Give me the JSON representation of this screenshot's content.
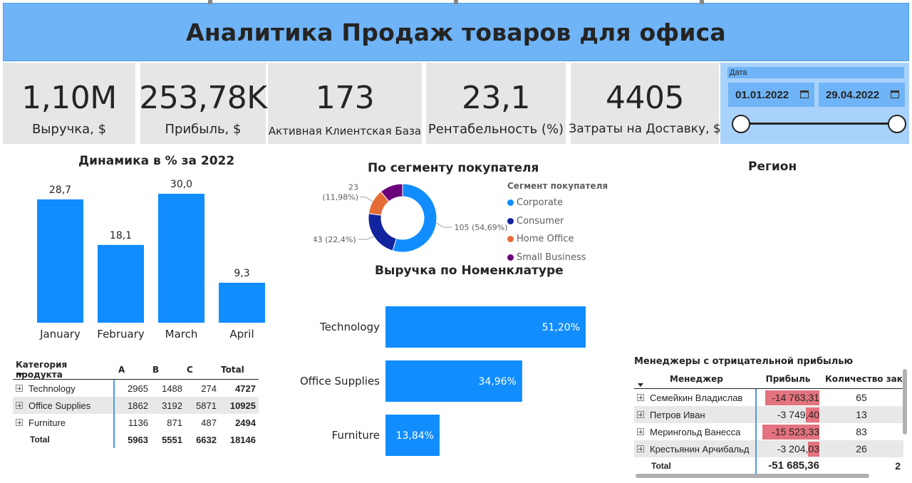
{
  "header": {
    "title": "Аналитика Продаж товаров для офиса"
  },
  "kpis": [
    {
      "value": "1,10M",
      "label": "Выручка, $"
    },
    {
      "value": "253,78K",
      "label": "Прибыль, $"
    },
    {
      "value": "173",
      "label": "Активная Клиентская База"
    },
    {
      "value": "23,1",
      "label": "Рентабельность (%)"
    },
    {
      "value": "4405",
      "label": "Затраты на Доставку, $"
    }
  ],
  "date_slicer": {
    "title": "Дата",
    "start": "01.01.2022",
    "end": "29.04.2022",
    "start_fraction": 0.0,
    "end_fraction": 1.0
  },
  "monthly_chart": {
    "title": "Динамика в % за 2022",
    "value_labels": [
      "28,7",
      "18,1",
      "30,0",
      "9,3"
    ],
    "categories": [
      "January",
      "February",
      "March",
      "April"
    ]
  },
  "segment_chart": {
    "title": "По сегменту покупателя",
    "legend_title": "Сегмент покупателя",
    "labels": [
      "105 (54,69%)",
      "43 (22,4%)",
      "23",
      "(11,98%)"
    ]
  },
  "nomenclature_chart": {
    "title": "Выручка по Номенклатуре",
    "value_labels": [
      "51,20%",
      "34,96%",
      "13,84%"
    ]
  },
  "region": {
    "title": "Регион"
  },
  "chart_data": [
    {
      "type": "bar",
      "title": "Динамика в % за 2022",
      "categories": [
        "January",
        "February",
        "March",
        "April"
      ],
      "values": [
        28.7,
        18.1,
        30.0,
        9.3
      ],
      "ylim": [
        0,
        30
      ],
      "color": "#118dff"
    },
    {
      "type": "pie",
      "title": "По сегменту покупателя",
      "legend_title": "Сегмент покупателя",
      "legend_position": "right",
      "slices": [
        {
          "name": "Corporate",
          "value": 105,
          "percent": 54.69,
          "color": "#118dff"
        },
        {
          "name": "Consumer",
          "value": 43,
          "percent": 22.4,
          "color": "#12239e"
        },
        {
          "name": "Home Office",
          "value": 23,
          "percent": 11.98,
          "color": "#e66c37"
        },
        {
          "name": "Small Business",
          "value": 21,
          "percent": 10.93,
          "color": "#6b007b"
        }
      ]
    },
    {
      "type": "bar",
      "title": "Выручка по Номенклатуре",
      "orientation": "horizontal",
      "categories": [
        "Technology",
        "Office Supplies",
        "Furniture"
      ],
      "values": [
        51.2,
        34.96,
        13.84
      ],
      "color": "#118dff"
    }
  ],
  "category_matrix": {
    "headers": [
      "Категория продукта",
      "A",
      "B",
      "C",
      "Total"
    ],
    "rows": [
      {
        "name": "Technology",
        "a": "2965",
        "b": "1488",
        "c": "274",
        "total": "4727"
      },
      {
        "name": "Office Supplies",
        "a": "1862",
        "b": "3192",
        "c": "5871",
        "total": "10925"
      },
      {
        "name": "Furniture",
        "a": "1136",
        "b": "871",
        "c": "487",
        "total": "2494"
      }
    ],
    "total_row": {
      "name": "Total",
      "a": "5963",
      "b": "5551",
      "c": "6632",
      "total": "18146"
    }
  },
  "managers_table": {
    "title": "Менеджеры с отрицательной прибылью",
    "headers": [
      "Менеджер",
      "Прибыль",
      "Количество зака"
    ],
    "rows": [
      {
        "name": "Семейкин Владислав",
        "profit": "-14 763,31",
        "profit_value": -14763.31,
        "count": "65"
      },
      {
        "name": "Петров Иван",
        "profit": "-3 749,40",
        "profit_value": -3749.4,
        "count": "13"
      },
      {
        "name": "Мерингольд Ванесса",
        "profit": "-15 523,33",
        "profit_value": -15523.33,
        "count": "83"
      },
      {
        "name": "Крестьянин Арчибальд",
        "profit": "-3 204,03",
        "profit_value": -3204.03,
        "count": "26"
      }
    ],
    "total": {
      "name": "Total",
      "profit": "-51 685,36",
      "count": "2"
    }
  }
}
